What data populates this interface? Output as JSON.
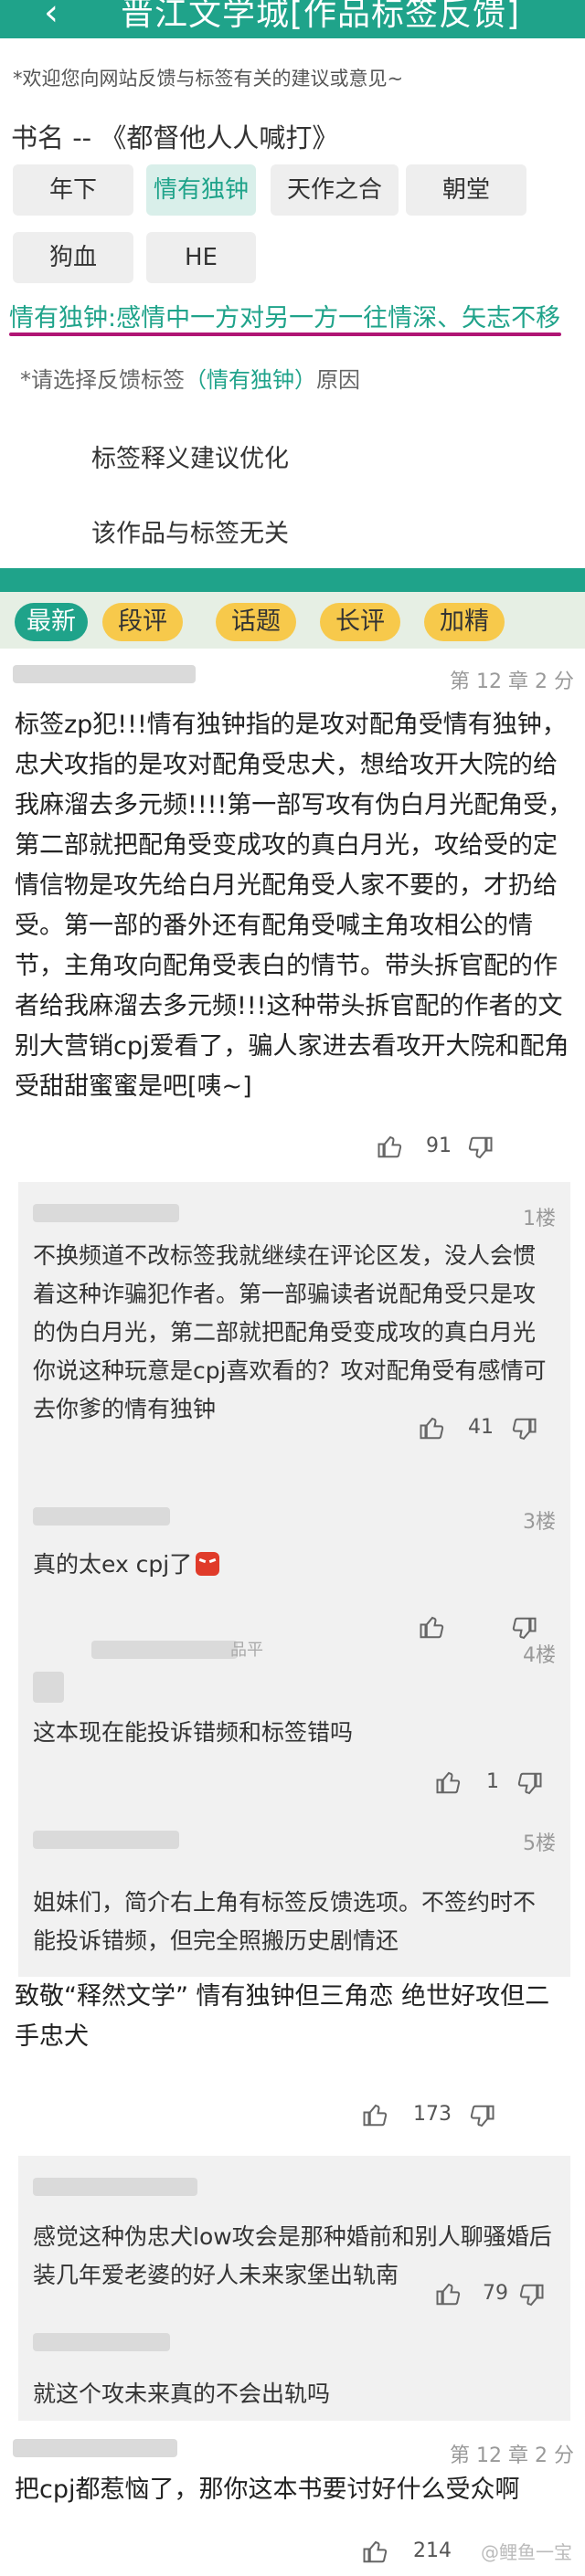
{
  "header": {
    "back_icon": "‹",
    "title": "晋江文学城[作品标签反馈]"
  },
  "notice": "*欢迎您向网站反馈与标签有关的建议或意见~",
  "book": {
    "label": "书名 -- 《都督他人人喊打》"
  },
  "tags": [
    {
      "label": "年下",
      "active": false
    },
    {
      "label": "情有独钟",
      "active": true
    },
    {
      "label": "天作之合",
      "active": false
    },
    {
      "label": "朝堂",
      "active": false
    },
    {
      "label": "狗血",
      "active": false
    },
    {
      "label": "HE",
      "active": false
    }
  ],
  "tag_definition": "情有独钟:感情中一方对另一方一往情深、矢志不移",
  "hint": {
    "prefix": "*请选择反馈标签",
    "tag": "（情有独钟）",
    "suffix": "原因"
  },
  "options": [
    "标签释义建议优化",
    "该作品与标签无关"
  ],
  "comment_tabs": [
    {
      "label": "最新",
      "active": true
    },
    {
      "label": "段评",
      "active": false
    },
    {
      "label": "话题",
      "active": false
    },
    {
      "label": "长评",
      "active": false
    },
    {
      "label": "加精",
      "active": false
    }
  ],
  "main_comment": {
    "meta": "第 12 章  2 分",
    "text": "标签zp犯!!!情有独钟指的是攻对配角受情有独钟，忠犬攻指的是攻对配角受忠犬，想给攻开大院的给我麻溜去多元频!!!!第一部写攻有伪白月光配角受，第二部就把配角受变成攻的真白月光，攻给受的定情信物是攻先给白月光配角受人家不要的，才扔给受。第一部的番外还有配角受喊主角攻相公的情节，主角攻向配角受表白的情节。带头拆官配的作者给我麻溜去多元频!!!这种带头拆官配的作者的文别大营销cpj爱看了，骗人家进去看攻开大院和配角受甜甜蜜蜜是吧[咦~]",
    "likes": "91"
  },
  "replies": [
    {
      "floor": "1楼",
      "text": "不换频道不改标签我就继续在评论区发，没人会惯着这种诈骗犯作者。第一部骗读者说配角受只是攻的伪白月光，第二部就把配角受变成攻的真白月光你说这种玩意是cpj喜欢看的？攻对配角受有感情可去你爹的情有独钟",
      "likes": "41"
    },
    {
      "floor": "3楼",
      "text": "真的太ex cpj了",
      "likes": ""
    },
    {
      "floor": "4楼",
      "name_fragment": "品平",
      "text": "这本现在能投诉错频和标签错吗",
      "likes": "1"
    },
    {
      "floor": "5楼",
      "text": "姐妹们，简介右上角有标签反馈选项。不签约时不能投诉错频，但完全照搬历史剧情还",
      "likes": ""
    }
  ],
  "comment2": {
    "text": "致敬“释然文学” 情有独钟但三角恋 绝世好攻但二手忠犬",
    "likes": "173"
  },
  "replies2": [
    {
      "text": "感觉这种伪忠犬low攻会是那种婚前和别人聊骚婚后装几年爱老婆的好人未来家堡出轨南",
      "likes": "79"
    },
    {
      "text": "就这个攻未来真的不会出轨吗",
      "likes": ""
    }
  ],
  "comment3": {
    "meta": "第 12 章  2 分",
    "text": "把cpj都惹恼了，那你这本书要讨好什么受众啊",
    "likes": "214"
  },
  "watermark": "@鲤鱼一宝"
}
